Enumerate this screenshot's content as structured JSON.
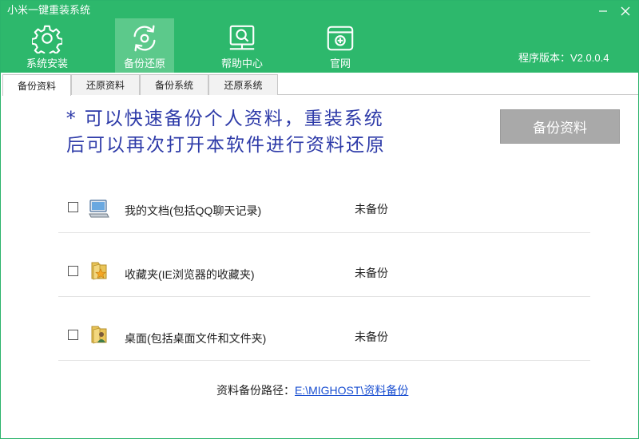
{
  "app": {
    "title": "小米一键重装系统",
    "version": "程序版本：V2.0.0.4"
  },
  "window_controls": {
    "minimize": "minimize-icon",
    "close": "close-icon"
  },
  "nav": [
    {
      "label": "系统安装",
      "icon": "gear-icon",
      "active": false
    },
    {
      "label": "备份还原",
      "icon": "refresh-icon",
      "active": true
    },
    {
      "label": "帮助中心",
      "icon": "monitor-help-icon",
      "active": false
    },
    {
      "label": "官网",
      "icon": "browser-icon",
      "active": false
    }
  ],
  "tabs": [
    {
      "label": "备份资料",
      "active": true
    },
    {
      "label": "还原资料",
      "active": false
    },
    {
      "label": "备份系统",
      "active": false
    },
    {
      "label": "还原系统",
      "active": false
    }
  ],
  "notice": {
    "line1": "* 可以快速备份个人资料，重装系统",
    "line2": "后可以再次打开本软件进行资料还原"
  },
  "backup_button": "备份资料",
  "items": [
    {
      "label": "我的文档(包括QQ聊天记录)",
      "status": "未备份",
      "icon": "computer-icon",
      "checked": false
    },
    {
      "label": "收藏夹(IE浏览器的收藏夹)",
      "status": "未备份",
      "icon": "favorites-folder-icon",
      "checked": false
    },
    {
      "label": "桌面(包括桌面文件和文件夹)",
      "status": "未备份",
      "icon": "desktop-folder-icon",
      "checked": false
    }
  ],
  "path": {
    "label": "资料备份路径：",
    "value": "E:\\MIGHOST\\资料备份"
  },
  "colors": {
    "header": "#2db86c",
    "active_nav": "#5cc98b",
    "notice_text": "#2d3aa8",
    "button_bg": "#a9a9a9",
    "link": "#1a4fd1"
  }
}
